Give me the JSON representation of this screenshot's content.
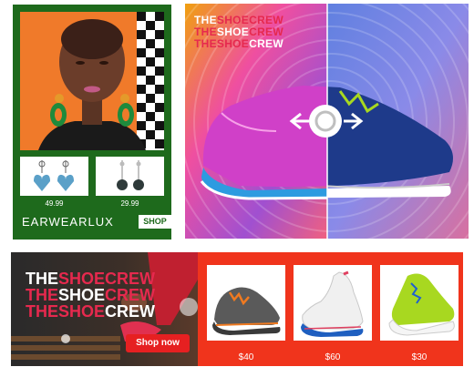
{
  "earwear": {
    "brand": "EARWEARLUX",
    "shop_label": "SHOP",
    "products": [
      {
        "price": "49.99"
      },
      {
        "price": "29.99"
      }
    ]
  },
  "slider": {
    "logo_lines": [
      {
        "a": "THE",
        "b": "SHOE",
        "c": "CREW"
      },
      {
        "a": "THE",
        "b": "SHOE",
        "c": "CREW"
      },
      {
        "a": "THE",
        "b": "SHOE",
        "c": "CREW"
      }
    ]
  },
  "banner": {
    "logo_lines": [
      {
        "a": "THE",
        "b": "SHOE",
        "c": "CREW"
      },
      {
        "a": "THE",
        "b": "SHOE",
        "c": "CREW"
      },
      {
        "a": "THE",
        "b": "SHOE",
        "c": "CREW"
      }
    ],
    "cta_label": "Shop now",
    "products": [
      {
        "price": "$40"
      },
      {
        "price": "$60"
      },
      {
        "price": "$30"
      }
    ]
  },
  "colors": {
    "earwear_green": "#1e6a1c",
    "banner_red": "#f0341c",
    "logo_red": "#e6294e",
    "cta_red": "#e62021"
  }
}
